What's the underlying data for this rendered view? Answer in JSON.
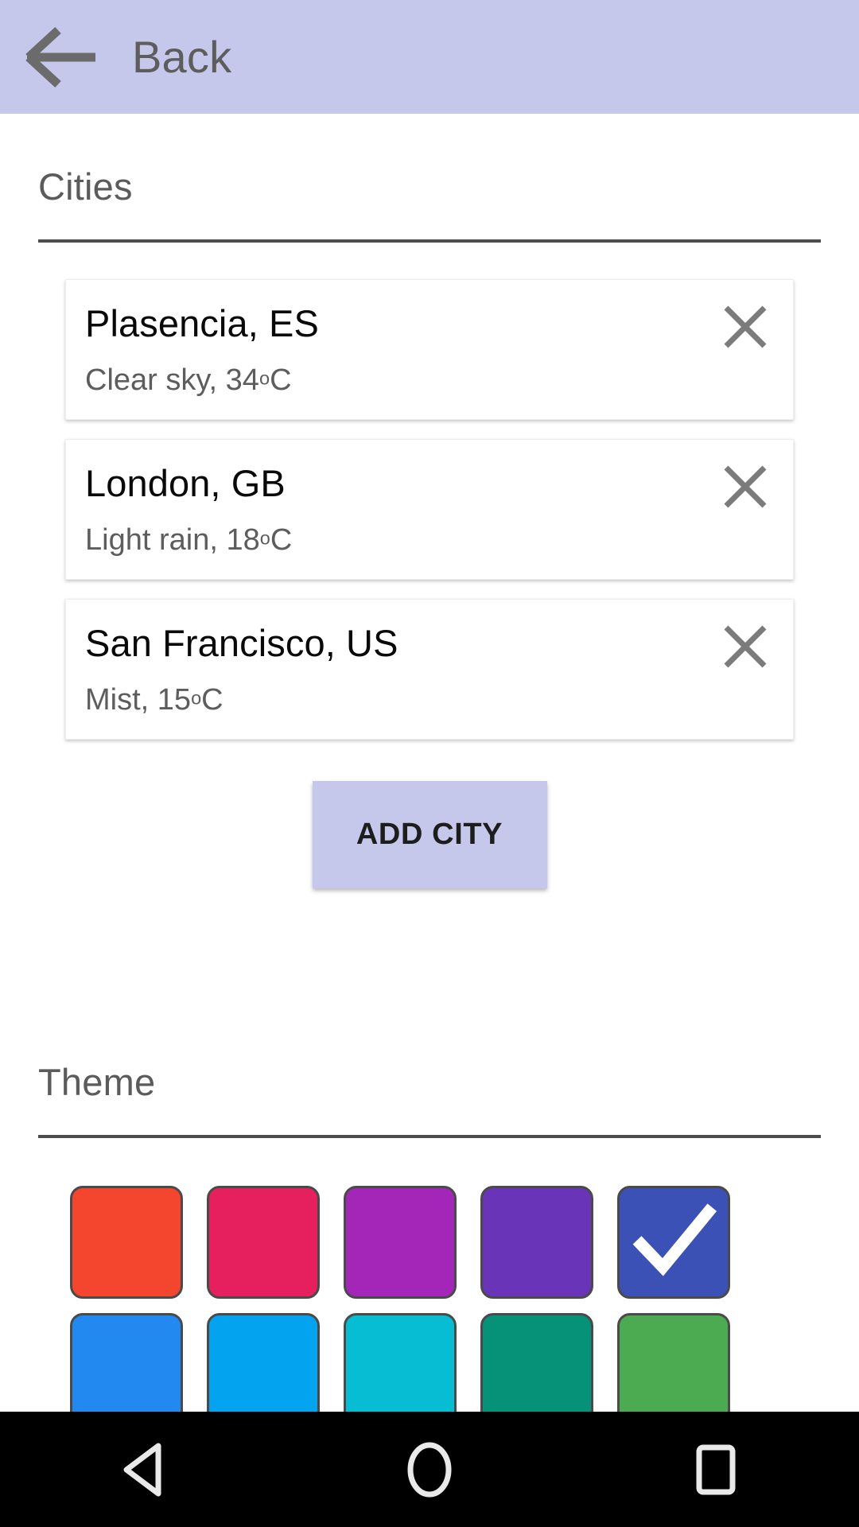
{
  "appbar": {
    "title": "Back",
    "background": "#c5c8ea",
    "icon_color": "#6b6b6b"
  },
  "cities_section": {
    "title": "Cities",
    "items": [
      {
        "name": "Plasencia, ES",
        "condition": "Clear sky, ",
        "temperature": "34",
        "unit": "C",
        "degree": "o"
      },
      {
        "name": "London, GB",
        "condition": "Light rain, ",
        "temperature": "18",
        "unit": "C",
        "degree": "o"
      },
      {
        "name": "San Francisco, US",
        "condition": "Mist, ",
        "temperature": "15",
        "unit": "C",
        "degree": "o"
      }
    ],
    "remove_icon": "close-icon",
    "add_button_label": "ADD CITY"
  },
  "theme_section": {
    "title": "Theme",
    "selected_index": 4,
    "swatches": [
      {
        "name": "red",
        "color": "#f4452e"
      },
      {
        "name": "pink",
        "color": "#e61f5e"
      },
      {
        "name": "purple",
        "color": "#a426b9"
      },
      {
        "name": "deep-purple",
        "color": "#6a34b8"
      },
      {
        "name": "indigo",
        "color": "#3b51b5"
      },
      {
        "name": "blue",
        "color": "#2189ef"
      },
      {
        "name": "light-blue",
        "color": "#03a3ef"
      },
      {
        "name": "cyan",
        "color": "#06bdd3"
      },
      {
        "name": "teal",
        "color": "#059279"
      },
      {
        "name": "green",
        "color": "#4cab51"
      }
    ]
  },
  "navbar": {
    "background": "#000000",
    "items": [
      {
        "name": "nav-back-button",
        "icon": "triangle-left-icon"
      },
      {
        "name": "nav-home-button",
        "icon": "circle-icon"
      },
      {
        "name": "nav-recents-button",
        "icon": "square-icon"
      }
    ]
  }
}
